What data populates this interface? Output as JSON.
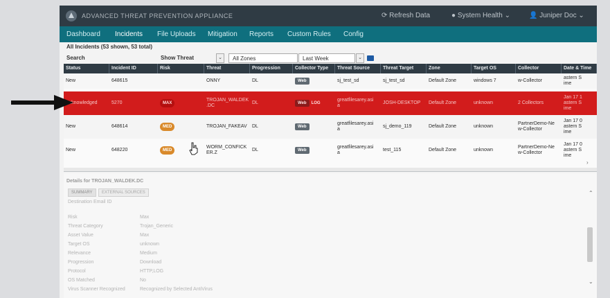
{
  "header": {
    "app_title": "ADVANCED THREAT PREVENTION APPLIANCE",
    "refresh": "Refresh Data",
    "system_health": "System Health",
    "user": "Juniper Doc"
  },
  "nav": {
    "tabs": [
      {
        "label": "Dashboard"
      },
      {
        "label": "Incidents"
      },
      {
        "label": "File Uploads"
      },
      {
        "label": "Mitigation"
      },
      {
        "label": "Reports"
      },
      {
        "label": "Custom Rules"
      },
      {
        "label": "Config"
      }
    ]
  },
  "incidents": {
    "summary": "All Incidents (53 shown, 53 total)",
    "filters": {
      "search_label": "Search",
      "threat_label": "Show Threat",
      "zones": "All Zones",
      "range": "Last Week"
    },
    "columns": [
      "Status",
      "Incident ID",
      "Risk",
      "Threat",
      "Progression",
      "Collector Type",
      "Threat Source",
      "Threat Target",
      "Zone",
      "Target OS",
      "Collector",
      "Date & Time"
    ],
    "partial_row": {
      "status": "New",
      "id": "648615",
      "threat": "ONNY",
      "progression": "DL",
      "collector_type": "Web",
      "source": "sj_test_sd",
      "target": "sj_test_sd",
      "zone": "Default Zone",
      "os": "windows 7",
      "collector": "w-Collector",
      "date": "astern S\nime"
    },
    "rows": [
      {
        "status": "Acknowledged",
        "id": "5270",
        "risk": "MAX",
        "threat": "TROJAN_WALDEK\n.DC",
        "progression": "DL",
        "collector_type": "Web",
        "collector_type2": "LOG",
        "source": "greatfilesarey.asi\na",
        "target": "JOSH-DESKTOP",
        "zone": "Default Zone",
        "os": "unknown",
        "collector": "2 Collectors",
        "date": "Jan 17 1\nastern S\nime"
      },
      {
        "status": "New",
        "id": "648614",
        "risk": "MED",
        "threat": "TROJAN_FAKEAV",
        "progression": "DL",
        "collector_type": "Web",
        "source": "greatfilesarey.asi\na",
        "target": "sj_demo_119",
        "zone": "Default Zone",
        "os": "unknown",
        "collector": "PartnerDemo-Ne\nw-Collector",
        "date": "Jan 17 0\nastern S\nime"
      },
      {
        "status": "New",
        "id": "648220",
        "risk": "MED",
        "threat": "WORM_CONFICK\nER.Z",
        "progression": "DL",
        "collector_type": "Web",
        "source": "greatfilesarey.asi\na",
        "target": "test_115",
        "zone": "Default Zone",
        "os": "unknown",
        "collector": "PartnerDemo-Ne\nw-Collector",
        "date": "Jan 17 0\nastern S\nime"
      }
    ]
  },
  "details": {
    "title": "Details for TROJAN_WALDEK.DC",
    "tabs": [
      "SUMMARY",
      "EXTERNAL SOURCES"
    ],
    "destination": "Destination Email ID",
    "fields": [
      {
        "label": "Risk",
        "value": "Max"
      },
      {
        "label": "Threat Category",
        "value": "Trojan_Generic"
      },
      {
        "label": "Asset Value",
        "value": "Max"
      },
      {
        "label": "Target OS",
        "value": "unknown"
      },
      {
        "label": "Relevance",
        "value": "Medium"
      },
      {
        "label": "Progression",
        "value": "Download"
      },
      {
        "label": "Protocol",
        "value": "HTTP,LOG"
      },
      {
        "label": "OS Matched",
        "value": "No"
      },
      {
        "label": "Virus Scanner Recognized",
        "value": "Recognized by Selected AntiVirus"
      }
    ]
  },
  "colors": {
    "header_bg": "#2f3b44",
    "nav_bg": "#0f6f7e",
    "highlight_row": "#d21c1c",
    "med_badge": "#d98a2b"
  }
}
